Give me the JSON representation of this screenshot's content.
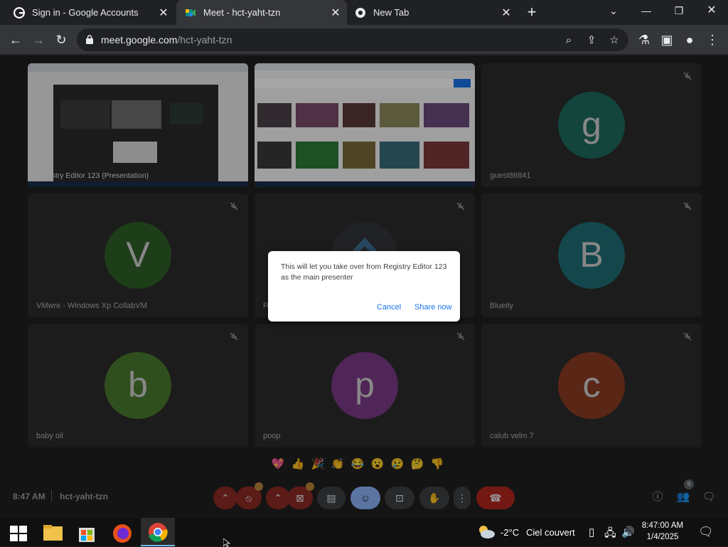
{
  "browser": {
    "tabs": [
      {
        "title": "Sign in - Google Accounts",
        "favicon": "google-icon",
        "active": false
      },
      {
        "title": "Meet - hct-yaht-tzn",
        "favicon": "meet-icon",
        "active": true
      },
      {
        "title": "New Tab",
        "favicon": "chrome-icon",
        "active": false
      }
    ],
    "new_tab_symbol": "+",
    "url_host": "meet.google.com",
    "url_path": "/hct-yaht-tzn"
  },
  "meet": {
    "meeting_time": "8:47 AM",
    "meeting_code": "hct-yaht-tzn",
    "participants": [
      {
        "name": "Registry Editor 123 (Presentation)",
        "type": "screen"
      },
      {
        "name": "",
        "type": "screen"
      },
      {
        "name": "guest86841",
        "initial": "g",
        "color": "#1e6b5e"
      },
      {
        "name": "VMwre - Windows Xp CollabVM",
        "initial": "V",
        "color": "#2e5f27"
      },
      {
        "name": "Re",
        "initial": "",
        "color": "#2b2b2b"
      },
      {
        "name": "Blueity",
        "initial": "B",
        "color": "#1f6d76"
      },
      {
        "name": "baby oil",
        "initial": "b",
        "color": "#4a7a2e"
      },
      {
        "name": "poop",
        "initial": "p",
        "color": "#7b3a86"
      },
      {
        "name": "calub velm 7",
        "initial": "c",
        "color": "#8a3b22"
      }
    ],
    "reactions": [
      "💖",
      "👍",
      "🎉",
      "👏",
      "😂",
      "😮",
      "😢",
      "🤔",
      "👎"
    ],
    "people_count": "9",
    "dialog": {
      "message": "This will let you take over from Registry Editor 123 as the main presenter",
      "cancel_label": "Cancel",
      "confirm_label": "Share now"
    }
  },
  "taskbar": {
    "weather_temp": "-2°C",
    "weather_text": "Ciel couvert",
    "time": "8:47:00 AM",
    "date": "1/4/2025"
  },
  "colors": {
    "accent": "#1a73e8",
    "end_call": "#b3261e",
    "active_control": "#8ab4f8"
  }
}
